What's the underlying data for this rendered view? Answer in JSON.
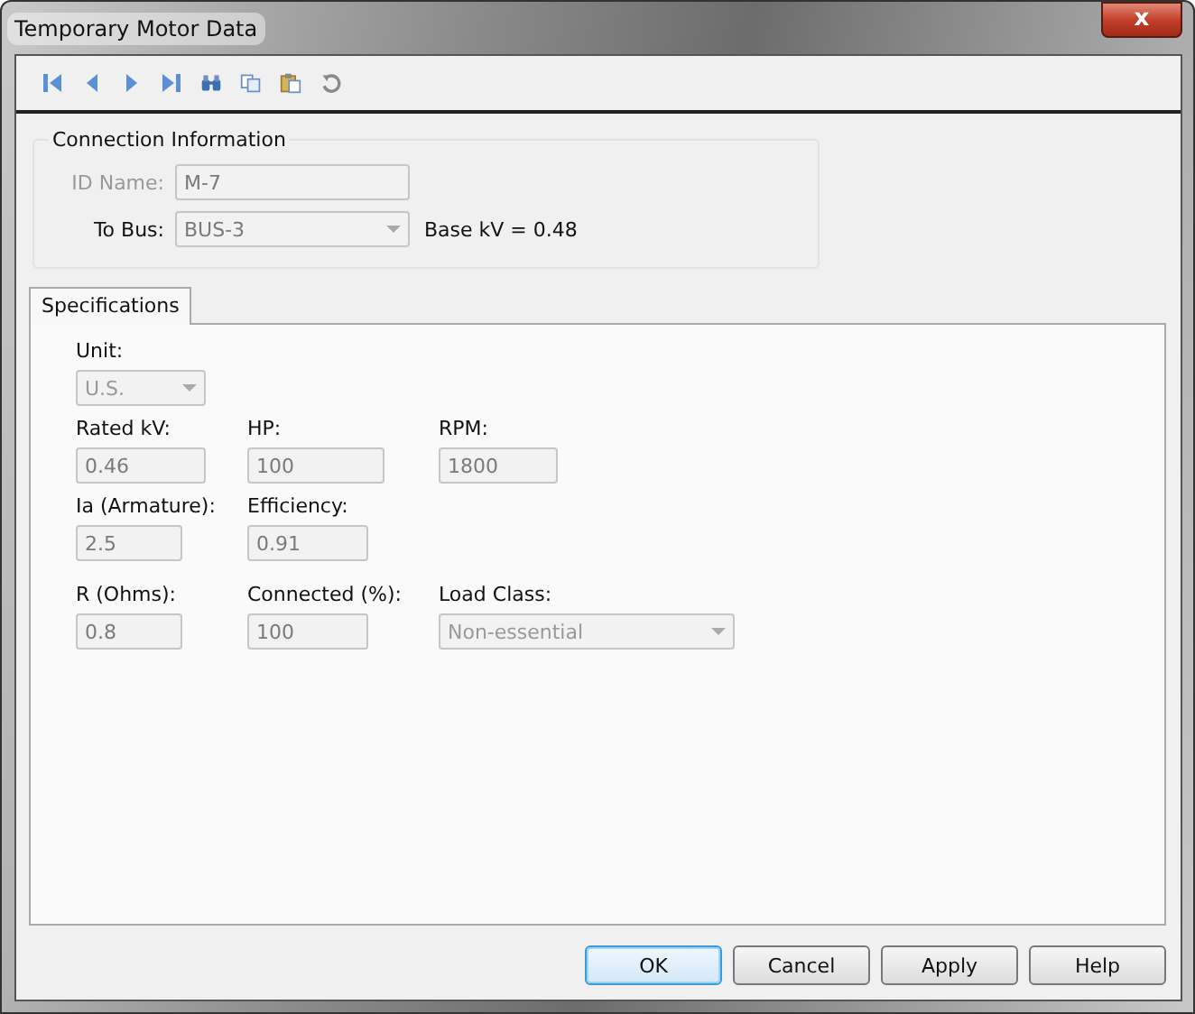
{
  "window": {
    "title": "Temporary Motor Data",
    "close": "x"
  },
  "connection": {
    "title": "Connection Information",
    "fields": [
      {
        "label": "ID Name:",
        "value": "M-7",
        "kind": "text",
        "disabled": true
      },
      {
        "label": "To Bus:",
        "value": "BUS-3",
        "kind": "dropdown",
        "disabled": false,
        "note": "Base kV = 0.48"
      }
    ]
  },
  "tabs": [
    {
      "label": "Specifications",
      "selected": true
    }
  ],
  "spec_rows": [
    [
      {
        "label": "Unit:",
        "value": "U.S.",
        "kind": "dropdown"
      }
    ],
    [
      {
        "label": "Rated kV:",
        "value": "0.46",
        "kind": "text"
      },
      {
        "label": "HP:",
        "value": "100",
        "kind": "text"
      },
      {
        "label": "RPM:",
        "value": "1800",
        "kind": "text"
      }
    ],
    [
      {
        "label": "Ia (Armature):",
        "value": "2.5",
        "kind": "text"
      },
      {
        "label": "Efficiency:",
        "value": "0.91",
        "kind": "text"
      }
    ],
    [
      {
        "label": "R (Ohms):",
        "value": "0.8",
        "kind": "text"
      },
      {
        "label": "Connected (%):",
        "value": "100",
        "kind": "text"
      },
      {
        "label": "Load Class:",
        "value": "Non-essential",
        "kind": "wide-dropdown"
      }
    ]
  ],
  "buttons": [
    {
      "label": "OK",
      "default": true
    },
    {
      "label": "Cancel",
      "default": false
    },
    {
      "label": "Apply",
      "default": false
    },
    {
      "label": "Help",
      "default": false
    }
  ]
}
